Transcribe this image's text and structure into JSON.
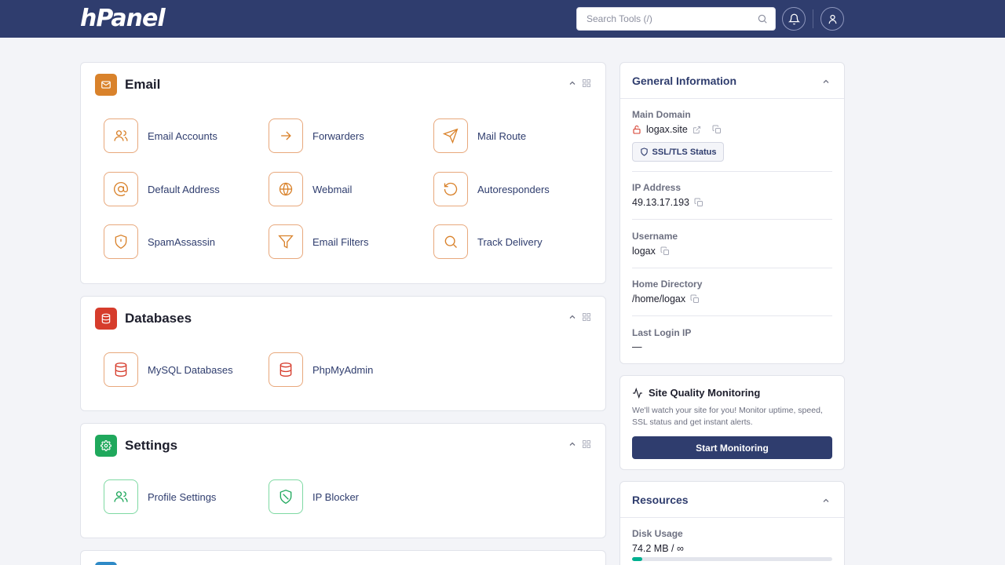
{
  "app": {
    "logo": "hPanel"
  },
  "topbar": {
    "search_placeholder": "Search Tools (/)"
  },
  "sections": {
    "email": {
      "title": "Email",
      "tools": [
        {
          "label": "Email Accounts",
          "icon": "users-icon"
        },
        {
          "label": "Forwarders",
          "icon": "arrow-right-icon"
        },
        {
          "label": "Mail Route",
          "icon": "send-icon"
        },
        {
          "label": "Default Address",
          "icon": "at-icon"
        },
        {
          "label": "Webmail",
          "icon": "globe-icon"
        },
        {
          "label": "Autoresponders",
          "icon": "rotate-ccw-icon"
        },
        {
          "label": "SpamAssassin",
          "icon": "shield-alert-icon"
        },
        {
          "label": "Email Filters",
          "icon": "filter-icon"
        },
        {
          "label": "Track Delivery",
          "icon": "search-icon"
        }
      ]
    },
    "databases": {
      "title": "Databases",
      "tools": [
        {
          "label": "MySQL Databases",
          "icon": "database-icon"
        },
        {
          "label": "PhpMyAdmin",
          "icon": "database-icon"
        }
      ]
    },
    "settings": {
      "title": "Settings",
      "tools": [
        {
          "label": "Profile Settings",
          "icon": "users-icon"
        },
        {
          "label": "IP Blocker",
          "icon": "shield-icon"
        }
      ]
    }
  },
  "general_info": {
    "title": "General Information",
    "main_domain_label": "Main Domain",
    "main_domain": "logax.site",
    "ssl_button": "SSL/TLS Status",
    "ip_label": "IP Address",
    "ip": "49.13.17.193",
    "username_label": "Username",
    "username": "logax",
    "home_label": "Home Directory",
    "home": "/home/logax",
    "last_login_label": "Last Login IP",
    "last_login": "—"
  },
  "site_quality": {
    "title": "Site Quality Monitoring",
    "text": "We'll watch your site for you! Monitor uptime, speed, SSL status and get instant alerts.",
    "button": "Start Monitoring"
  },
  "resources": {
    "title": "Resources",
    "disk_label": "Disk Usage",
    "disk_value": "74.2 MB / ∞",
    "disk_fraction": 0.05
  },
  "colors": {
    "topbar": "#2f3d6e",
    "email_badge": "#d9822b",
    "database_badge": "#d63c2c",
    "settings_badge": "#1fa85c",
    "email_icon": "#d9822b",
    "database_icon": "#d63c2c",
    "settings_icon": "#1fa85c",
    "progress": "#00b090"
  }
}
